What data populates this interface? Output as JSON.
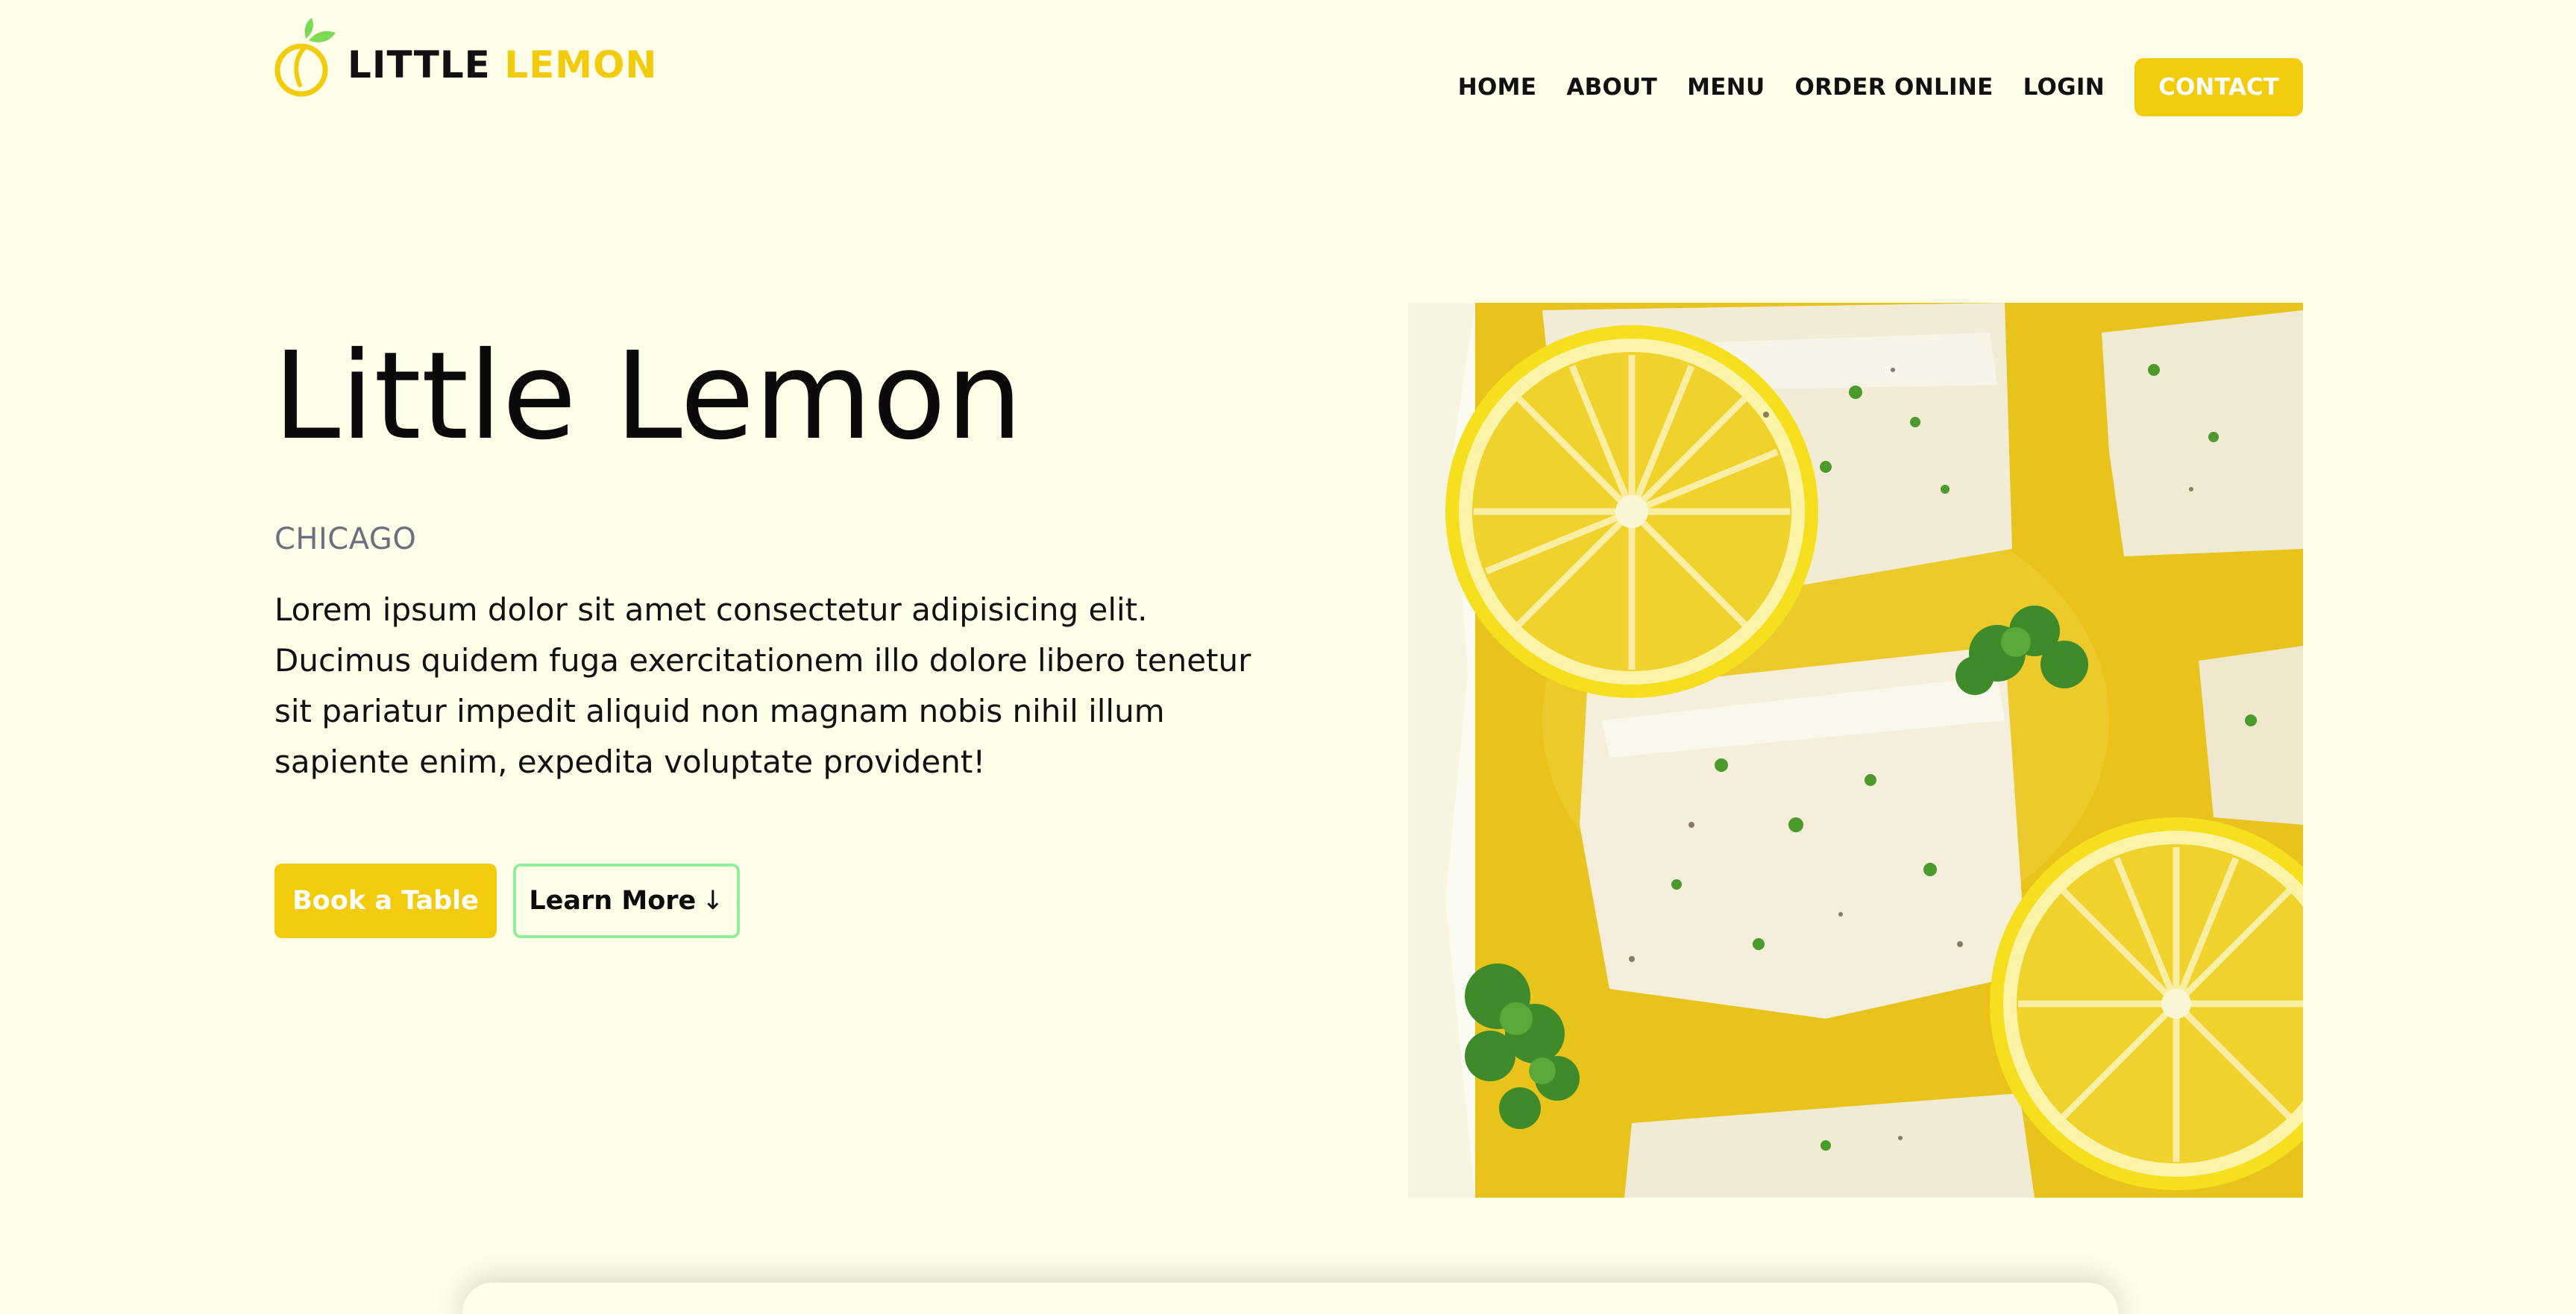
{
  "brand": {
    "word1": "LITTLE",
    "word2": "LEMON",
    "logo_icon": "lemon-icon",
    "colors": {
      "primary_yellow": "#f2cc0c",
      "background": "#fefee9",
      "text": "#111111",
      "muted": "#6b7080",
      "learn_more_border": "#8ef09a"
    }
  },
  "nav": {
    "items": [
      "HOME",
      "ABOUT",
      "MENU",
      "ORDER ONLINE",
      "LOGIN"
    ],
    "contact_label": "CONTACT"
  },
  "hero": {
    "title": "Little Lemon",
    "city": "CHICAGO",
    "description": "Lorem ipsum dolor sit amet consectetur adipisicing elit.\nDucimus quidem fuga exercitationem illo dolore libero tenetur\nsit pariatur impedit aliquid non magnam nobis nihil illum\nsapiente enim, expedita voluptate provident!",
    "book_label": "Book a Table",
    "learn_label": "Learn More",
    "learn_icon": "arrow-down-icon",
    "image": "lemon-fish-photo"
  }
}
